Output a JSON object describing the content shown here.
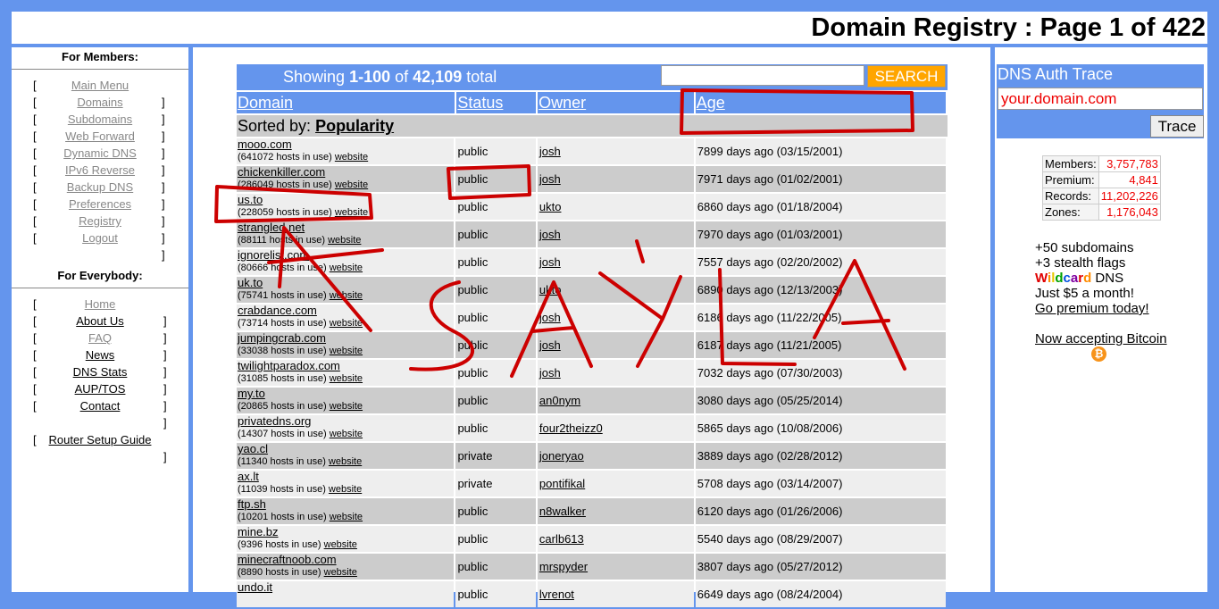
{
  "header": {
    "title": "Domain Registry : Page 1 of 422"
  },
  "members": {
    "title": "For Members:",
    "items": [
      {
        "label": "Main Menu"
      },
      {
        "label": "Domains"
      },
      {
        "label": "Subdomains"
      },
      {
        "label": "Web Forward"
      },
      {
        "label": "Dynamic DNS"
      },
      {
        "label": "IPv6 Reverse"
      },
      {
        "label": "Backup DNS"
      },
      {
        "label": "Preferences"
      },
      {
        "label": "Registry"
      },
      {
        "label": "Logout"
      }
    ]
  },
  "everybody": {
    "title": "For Everybody:",
    "items": [
      {
        "label": "Home"
      },
      {
        "label": "About Us"
      },
      {
        "label": "FAQ"
      },
      {
        "label": "News"
      },
      {
        "label": "DNS Stats"
      },
      {
        "label": "AUP/TOS"
      },
      {
        "label": "Contact"
      }
    ],
    "router_guide": "Router Setup Guide"
  },
  "search_bar": {
    "showing_prefix": "Showing",
    "range": "1-100",
    "of": "of",
    "total_count": "42,109",
    "total_suffix": "total",
    "search_placeholder": "",
    "search_button": "SEARCH"
  },
  "columns": [
    "Domain",
    "Status",
    "Owner",
    "Age"
  ],
  "sorted": {
    "prefix": "Sorted by:",
    "field": "Popularity"
  },
  "rows": [
    {
      "domain": "mooo.com",
      "hosts": "(641072 hosts in use)",
      "website": "website",
      "status": "public",
      "owner": "josh",
      "age": "7899 days ago (03/15/2001)"
    },
    {
      "domain": "chickenkiller.com",
      "hosts": "(286049 hosts in use)",
      "website": "website",
      "status": "public",
      "owner": "josh",
      "age": "7971 days ago (01/02/2001)"
    },
    {
      "domain": "us.to",
      "hosts": "(228059 hosts in use)",
      "website": "website",
      "status": "public",
      "owner": "ukto",
      "age": "6860 days ago (01/18/2004)"
    },
    {
      "domain": "strangled.net",
      "hosts": "(88111 hosts in use)",
      "website": "website",
      "status": "public",
      "owner": "josh",
      "age": "7970 days ago (01/03/2001)"
    },
    {
      "domain": "ignorelist.com",
      "hosts": "(80666 hosts in use)",
      "website": "website",
      "status": "public",
      "owner": "josh",
      "age": "7557 days ago (02/20/2002)"
    },
    {
      "domain": "uk.to",
      "hosts": "(75741 hosts in use)",
      "website": "website",
      "status": "public",
      "owner": "ukto",
      "age": "6890 days ago (12/13/2003)"
    },
    {
      "domain": "crabdance.com",
      "hosts": "(73714 hosts in use)",
      "website": "website",
      "status": "public",
      "owner": "josh",
      "age": "6186 days ago (11/22/2005)"
    },
    {
      "domain": "jumpingcrab.com",
      "hosts": "(33038 hosts in use)",
      "website": "website",
      "status": "public",
      "owner": "josh",
      "age": "6187 days ago (11/21/2005)"
    },
    {
      "domain": "twilightparadox.com",
      "hosts": "(31085 hosts in use)",
      "website": "website",
      "status": "public",
      "owner": "josh",
      "age": "7032 days ago (07/30/2003)"
    },
    {
      "domain": "my.to",
      "hosts": "(20865 hosts in use)",
      "website": "website",
      "status": "public",
      "owner": "an0nym",
      "age": "3080 days ago (05/25/2014)"
    },
    {
      "domain": "privatedns.org",
      "hosts": "(14307 hosts in use)",
      "website": "website",
      "status": "public",
      "owner": "four2theizz0",
      "age": "5865 days ago (10/08/2006)"
    },
    {
      "domain": "yao.cl",
      "hosts": "(11340 hosts in use)",
      "website": "website",
      "status": "private",
      "owner": "joneryao",
      "age": "3889 days ago (02/28/2012)"
    },
    {
      "domain": "ax.lt",
      "hosts": "(11039 hosts in use)",
      "website": "website",
      "status": "private",
      "owner": "pontifikal",
      "age": "5708 days ago (03/14/2007)"
    },
    {
      "domain": "ftp.sh",
      "hosts": "(10201 hosts in use)",
      "website": "website",
      "status": "public",
      "owner": "n8walker",
      "age": "6120 days ago (01/26/2006)"
    },
    {
      "domain": "mine.bz",
      "hosts": "(9396 hosts in use)",
      "website": "website",
      "status": "public",
      "owner": "carlb613",
      "age": "5540 days ago (08/29/2007)"
    },
    {
      "domain": "minecraftnoob.com",
      "hosts": "(8890 hosts in use)",
      "website": "website",
      "status": "public",
      "owner": "mrspyder",
      "age": "3807 days ago (05/27/2012)"
    },
    {
      "domain": "undo.it",
      "hosts": "",
      "website": "",
      "status": "public",
      "owner": "lvrenot",
      "age": "6649 days ago (08/24/2004)"
    }
  ],
  "trace": {
    "title": "DNS Auth Trace",
    "input_value": "your.domain.com",
    "button": "Trace"
  },
  "stats": [
    {
      "label": "Members:",
      "value": "3,757,783"
    },
    {
      "label": "Premium:",
      "value": "4,841"
    },
    {
      "label": "Records:",
      "value": "11,202,226"
    },
    {
      "label": "Zones:",
      "value": "1,176,043"
    }
  ],
  "promo": {
    "line1": "+50 subdomains",
    "line2": "+3 stealth flags",
    "wildcard_letters": [
      "W",
      "i",
      "l",
      "d",
      "c",
      "a",
      "r",
      "d"
    ],
    "wildcard_colors": [
      "#e00000",
      "#ff8c00",
      "#e6c800",
      "#00a000",
      "#0050e0",
      "#8000a0",
      "#e00000",
      "#ff8c00"
    ],
    "dns_word": "DNS",
    "line4": "Just $5 a month!",
    "premium_link": "Go premium today!",
    "bitcoin_link": "Now accepting Bitcoin",
    "bitcoin_glyph": "₿"
  },
  "scribble": {
    "text": "ASYLA",
    "color": "#cc0000"
  }
}
